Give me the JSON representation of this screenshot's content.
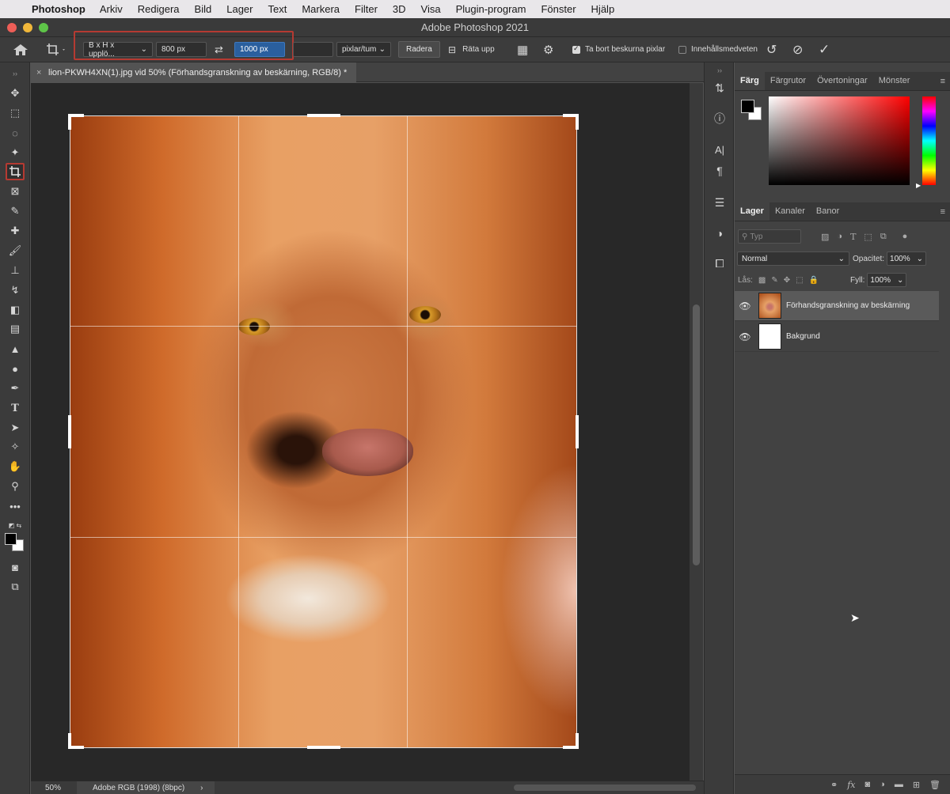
{
  "menubar": {
    "app_name": "Photoshop",
    "items": [
      "Arkiv",
      "Redigera",
      "Bild",
      "Lager",
      "Text",
      "Markera",
      "Filter",
      "3D",
      "Visa",
      "Plugin-program",
      "Fönster",
      "Hjälp"
    ]
  },
  "window": {
    "title": "Adobe Photoshop 2021"
  },
  "options": {
    "ratio_select": "B x H x upplö...",
    "width_value": "800 px",
    "height_value": "1000 px",
    "resolution_value": "",
    "unit_select": "pixlar/tum",
    "clear_label": "Radera",
    "straighten_label": "Räta upp",
    "delete_cropped_label": "Ta bort beskurna pixlar",
    "delete_cropped_checked": true,
    "content_aware_label": "Innehållsmedveten",
    "content_aware_checked": false
  },
  "document": {
    "tab_title": "lion-PKWH4XN(1).jpg vid 50% (Förhandsgranskning av beskärning, RGB/8) *"
  },
  "status": {
    "zoom": "50%",
    "profile": "Adobe RGB (1998) (8bpc)"
  },
  "color_panel": {
    "tabs": [
      "Färg",
      "Färgrutor",
      "Övertoningar",
      "Mönster"
    ],
    "active_tab": "Färg",
    "foreground": "#000000",
    "background": "#ffffff"
  },
  "layers_panel": {
    "tabs": [
      "Lager",
      "Kanaler",
      "Banor"
    ],
    "active_tab": "Lager",
    "filter_placeholder": "Typ",
    "blend_mode": "Normal",
    "opacity_label": "Opacitet:",
    "opacity_value": "100%",
    "lock_label": "Lås:",
    "fill_label": "Fyll:",
    "fill_value": "100%",
    "layers": [
      {
        "name": "Förhandsgranskning av beskärning",
        "visible": true,
        "selected": true
      },
      {
        "name": "Bakgrund",
        "visible": true,
        "selected": false
      }
    ]
  },
  "colors": {
    "highlight_red": "#b53a32",
    "selection_blue": "#2a5f9e"
  }
}
